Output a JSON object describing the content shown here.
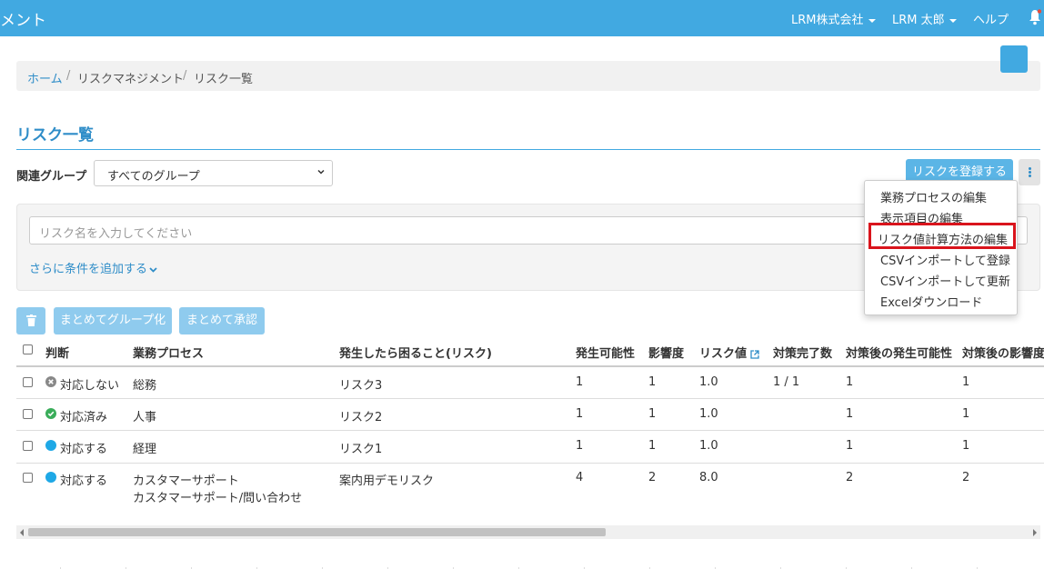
{
  "header": {
    "brand": "メント",
    "company": "LRM株式会社",
    "user": "LRM 太郎",
    "help": "ヘルプ",
    "bell_icon": "bell-icon"
  },
  "breadcrumb": {
    "home": "ホーム",
    "section": "リスクマネジメント",
    "current": "リスク一覧",
    "separator": "/"
  },
  "page": {
    "title": "リスク一覧"
  },
  "filter": {
    "group_label": "関連グループ",
    "group_value": "すべてのグループ",
    "register_button": "リスクを登録する",
    "search_placeholder": "リスク名を入力してください",
    "add_condition": "さらに条件を追加する"
  },
  "actions": {
    "delete_icon": "trash-icon",
    "group_button": "まとめてグループ化",
    "approve_button": "まとめて承認"
  },
  "menu": {
    "items": [
      "業務プロセスの編集",
      "表示項目の編集",
      "リスク値計算方法の編集",
      "CSVインポートして登録",
      "CSVインポートして更新",
      "Excelダウンロード"
    ]
  },
  "table": {
    "columns": [
      "判断",
      "業務プロセス",
      "発生したら困ること(リスク)",
      "発生可能性",
      "影響度",
      "リスク値",
      "対策完了数",
      "対策後の発生可能性",
      "対策後の影響度"
    ],
    "rows": [
      {
        "status": "対応しない",
        "status_icon": "x-circle-icon",
        "process": "総務",
        "process2": "",
        "risk": "リスク3",
        "likelihood": "1",
        "impact": "1",
        "risk_value": "1.0",
        "done": "1 / 1",
        "after_likelihood": "1",
        "after_impact": "1"
      },
      {
        "status": "対応済み",
        "status_icon": "check-circle-icon",
        "process": "人事",
        "process2": "",
        "risk": "リスク2",
        "likelihood": "1",
        "impact": "1",
        "risk_value": "1.0",
        "done": "",
        "after_likelihood": "1",
        "after_impact": "1"
      },
      {
        "status": "対応する",
        "status_icon": "circle-icon",
        "process": "経理",
        "process2": "",
        "risk": "リスク1",
        "likelihood": "1",
        "impact": "1",
        "risk_value": "1.0",
        "done": "",
        "after_likelihood": "1",
        "after_impact": "1"
      },
      {
        "status": "対応する",
        "status_icon": "circle-icon",
        "process": "カスタマーサポート",
        "process2": "カスタマーサポート/問い合わせ",
        "risk": "案内用デモリスク",
        "likelihood": "4",
        "impact": "2",
        "risk_value": "8.0",
        "done": "",
        "after_likelihood": "2",
        "after_impact": "2"
      }
    ]
  },
  "colors": {
    "header": "#41a9e1",
    "link": "#2f8dc8",
    "status_gray": "#888888",
    "status_green": "#3aad5a",
    "status_blue": "#1ea8e6",
    "highlight": "#d9141c"
  }
}
